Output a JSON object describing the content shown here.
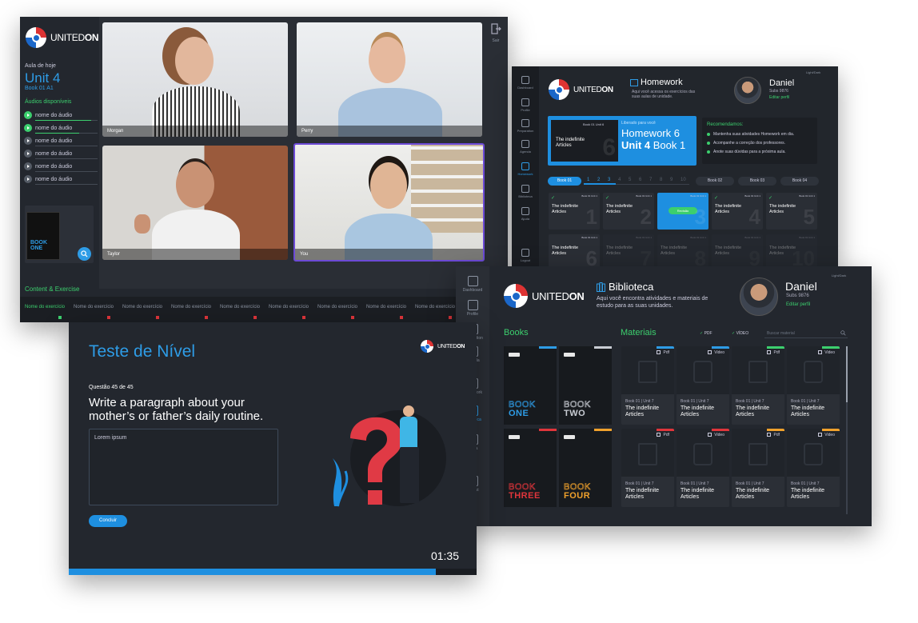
{
  "call": {
    "logo": "UNITEDON",
    "exit_label": "Sair",
    "lesson_label": "Aula de hoje",
    "unit": "Unit 4",
    "book": "Book 01 A1",
    "audios_label": "Áudios disponíveis",
    "audios": [
      "nome do áudio",
      "nome do áudio",
      "nome do áudio",
      "nome do áudio",
      "nome do áudio",
      "nome do áudio"
    ],
    "participants": [
      "Morgan",
      "Perry",
      "Taylor",
      "You"
    ],
    "section_label": "Content & Exercise",
    "exercise_label": "Nome do exercício",
    "book_cover": "BOOK ONE"
  },
  "homework": {
    "logo": "UNITEDON",
    "title": "Homework",
    "subtitle": "Aqui você acessa os exercícios das suas aulas de unidade.",
    "user_name": "Daniel",
    "user_subs": "Subs 9876",
    "edit_profile": "Editar perfil",
    "top_right": "Light/Dark",
    "nav": [
      "Dashboard",
      "Profile",
      "Preparation",
      "Agenda",
      "Homework",
      "Biblioteca",
      "Ajuda",
      "Logout"
    ],
    "hero": {
      "tag": "Liberado para você",
      "title": "Homework 6",
      "unit": "Unit 4",
      "book": "Book 1",
      "card_label": "Book 01 Unit 6",
      "card_title": "The indefinite Articles",
      "num": "6"
    },
    "recommend_title": "Recomendamos:",
    "recommend": [
      "Mantenha suas atividades Homework em dia.",
      "Acompanhe a correção dos professores.",
      "Anote suas dúvidas para a próxima aula."
    ],
    "book_tabs": [
      "Book 01",
      "Book 02",
      "Book 03",
      "Book 04"
    ],
    "pages": [
      "1",
      "2",
      "3",
      "4",
      "5",
      "6",
      "7",
      "8",
      "9",
      "10"
    ],
    "card_title": "The indefinite Articles",
    "card_label": "Book 01 Unit 1",
    "review_label": "Revisão",
    "row1_nums": [
      "1",
      "2",
      "3",
      "4",
      "5"
    ],
    "row2_nums": [
      "6",
      "7",
      "8",
      "9",
      "10"
    ]
  },
  "test": {
    "title": "Teste de Nível",
    "logo": "UNITEDON",
    "question_count": "Questão 45 de 45",
    "question": "Write a paragraph about your mother’s or father’s daily routine.",
    "answer": "Lorem ipsum",
    "submit": "Concluir",
    "timer": "01:35",
    "progress": 0.9
  },
  "library": {
    "logo": "UNITEDON",
    "title": "Biblioteca",
    "subtitle": "Aqui você encontra atividades e materiais de estudo para as suas unidades.",
    "user_name": "Daniel",
    "user_subs": "Subs 9876",
    "edit_profile": "Editar perfil",
    "top_right": "Light/Dark",
    "nav": [
      "Dashboard",
      "Profile",
      "Preparation",
      "Agenda",
      "Homework",
      "Biblioteca",
      "Ajuda",
      "Logout"
    ],
    "books_label": "Books",
    "materials_label": "Materiais",
    "filter_pdf": "PDF",
    "filter_video": "VÍDEO",
    "search_placeholder": "Buscar material",
    "books": [
      {
        "word": "BOOK",
        "num": "ONE",
        "color": "#2e9ce6"
      },
      {
        "word": "BOOK",
        "num": "TWO",
        "color": "#c9cdd4"
      },
      {
        "word": "BOOK",
        "num": "THREE",
        "color": "#e0353b"
      },
      {
        "word": "BOOK",
        "num": "FOUR",
        "color": "#f0a12c"
      }
    ],
    "materials": [
      {
        "kind": "Pdf",
        "unit": "Book 01 | Unit 7",
        "title": "The indefinite Articles",
        "color": "#2e9ce6"
      },
      {
        "kind": "Video",
        "unit": "Book 01 | Unit 7",
        "title": "The indefinite Articles",
        "color": "#2e9ce6"
      },
      {
        "kind": "Pdf",
        "unit": "Book 01 | Unit 7",
        "title": "The indefinite Articles",
        "color": "#3ccf6e"
      },
      {
        "kind": "Video",
        "unit": "Book 01 | Unit 7",
        "title": "The indefinite Articles",
        "color": "#3ccf6e"
      },
      {
        "kind": "Pdf",
        "unit": "Book 01 | Unit 7",
        "title": "The indefinite Articles",
        "color": "#e0353b"
      },
      {
        "kind": "Video",
        "unit": "Book 01 | Unit 7",
        "title": "The indefinite Articles",
        "color": "#e0353b"
      },
      {
        "kind": "Pdf",
        "unit": "Book 01 | Unit 7",
        "title": "The indefinite Articles",
        "color": "#f0a12c"
      },
      {
        "kind": "Video",
        "unit": "Book 01 | Unit 7",
        "title": "The indefinite Articles",
        "color": "#f0a12c"
      }
    ]
  }
}
